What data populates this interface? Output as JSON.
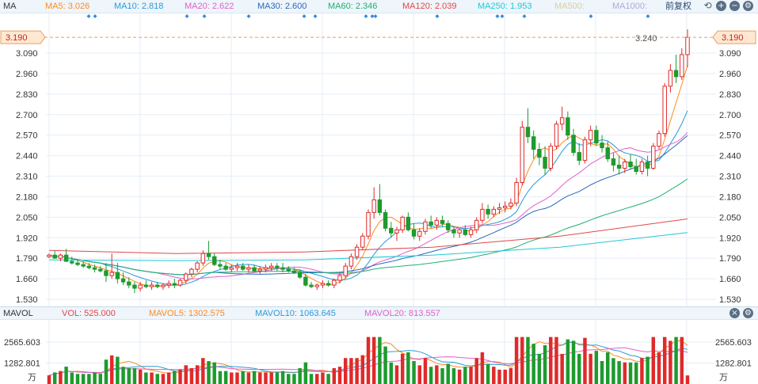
{
  "ma_bar": {
    "title": "MA",
    "items": [
      {
        "label": "MA5: 3.026",
        "color": "#ff8a1e"
      },
      {
        "label": "MA10: 2.818",
        "color": "#2a9bd8"
      },
      {
        "label": "MA20: 2.622",
        "color": "#e060c8"
      },
      {
        "label": "MA30: 2.600",
        "color": "#2b66c0"
      },
      {
        "label": "MA60: 2.346",
        "color": "#20b070"
      },
      {
        "label": "MA120: 2.039",
        "color": "#e04848"
      },
      {
        "label": "MA250: 1.953",
        "color": "#20c8d8"
      },
      {
        "label": "MA500:",
        "color": "#d8d0a0"
      },
      {
        "label": "MA1000:",
        "color": "#b0a8d8"
      }
    ],
    "adjust_label": "前复权"
  },
  "vol_bar": {
    "title": "MAVOL",
    "items": [
      {
        "label": "VOL: 525.000",
        "color": "#e04848"
      },
      {
        "label": "MAVOL5: 1302.575",
        "color": "#ff8a1e"
      },
      {
        "label": "MAVOL10: 1063.645",
        "color": "#2a9bd8"
      },
      {
        "label": "MAVOL20: 813.557",
        "color": "#e060c8"
      }
    ]
  },
  "price_axis": {
    "ticks": [
      "3.090",
      "2.960",
      "2.830",
      "2.700",
      "2.570",
      "2.440",
      "2.310",
      "2.180",
      "2.050",
      "1.920",
      "1.790",
      "1.660",
      "1.530"
    ],
    "current_price": "3.190",
    "high_marker": "3.240"
  },
  "volume_axis": {
    "ticks": [
      "2565.603",
      "1282.801"
    ],
    "unit": "万"
  },
  "colors": {
    "up": "#e02a2a",
    "down": "#1e9a2e",
    "grid": "#e6eef6",
    "price_line": "#e8a060",
    "label_box_bg": "#ffe8d2"
  },
  "icons": [
    "restore-icon",
    "zoom-in-icon",
    "zoom-out-icon",
    "settings-icon",
    "close-icon"
  ],
  "chart_data": {
    "type": "candlestick",
    "y_range": [
      1.53,
      3.24
    ],
    "ohlc": [
      [
        1.8,
        1.82,
        1.79,
        1.81
      ],
      [
        1.81,
        1.84,
        1.8,
        1.79
      ],
      [
        1.79,
        1.82,
        1.77,
        1.81
      ],
      [
        1.81,
        1.85,
        1.79,
        1.77
      ],
      [
        1.77,
        1.8,
        1.75,
        1.76
      ],
      [
        1.76,
        1.78,
        1.74,
        1.75
      ],
      [
        1.75,
        1.77,
        1.73,
        1.74
      ],
      [
        1.74,
        1.76,
        1.72,
        1.73
      ],
      [
        1.73,
        1.75,
        1.7,
        1.72
      ],
      [
        1.72,
        1.74,
        1.7,
        1.71
      ],
      [
        1.71,
        1.76,
        1.64,
        1.68
      ],
      [
        1.68,
        1.82,
        1.66,
        1.7
      ],
      [
        1.7,
        1.76,
        1.63,
        1.66
      ],
      [
        1.66,
        1.7,
        1.62,
        1.64
      ],
      [
        1.64,
        1.67,
        1.6,
        1.62
      ],
      [
        1.62,
        1.64,
        1.57,
        1.6
      ],
      [
        1.6,
        1.64,
        1.58,
        1.62
      ],
      [
        1.62,
        1.65,
        1.6,
        1.61
      ],
      [
        1.61,
        1.64,
        1.59,
        1.62
      ],
      [
        1.62,
        1.64,
        1.6,
        1.61
      ],
      [
        1.61,
        1.63,
        1.59,
        1.62
      ],
      [
        1.62,
        1.65,
        1.6,
        1.63
      ],
      [
        1.63,
        1.66,
        1.6,
        1.62
      ],
      [
        1.62,
        1.66,
        1.61,
        1.65
      ],
      [
        1.65,
        1.7,
        1.63,
        1.69
      ],
      [
        1.69,
        1.73,
        1.67,
        1.72
      ],
      [
        1.72,
        1.77,
        1.7,
        1.76
      ],
      [
        1.76,
        1.84,
        1.74,
        1.82
      ],
      [
        1.82,
        1.9,
        1.78,
        1.8
      ],
      [
        1.8,
        1.82,
        1.74,
        1.75
      ],
      [
        1.75,
        1.78,
        1.72,
        1.74
      ],
      [
        1.74,
        1.76,
        1.71,
        1.72
      ],
      [
        1.72,
        1.75,
        1.7,
        1.73
      ],
      [
        1.73,
        1.76,
        1.71,
        1.74
      ],
      [
        1.74,
        1.76,
        1.71,
        1.72
      ],
      [
        1.72,
        1.75,
        1.7,
        1.73
      ],
      [
        1.73,
        1.75,
        1.7,
        1.71
      ],
      [
        1.71,
        1.74,
        1.69,
        1.72
      ],
      [
        1.72,
        1.75,
        1.7,
        1.73
      ],
      [
        1.73,
        1.76,
        1.71,
        1.74
      ],
      [
        1.74,
        1.76,
        1.71,
        1.73
      ],
      [
        1.73,
        1.76,
        1.7,
        1.72
      ],
      [
        1.72,
        1.74,
        1.7,
        1.71
      ],
      [
        1.71,
        1.73,
        1.69,
        1.7
      ],
      [
        1.7,
        1.72,
        1.66,
        1.67
      ],
      [
        1.67,
        1.69,
        1.61,
        1.62
      ],
      [
        1.62,
        1.64,
        1.6,
        1.61
      ],
      [
        1.61,
        1.63,
        1.59,
        1.62
      ],
      [
        1.62,
        1.65,
        1.6,
        1.63
      ],
      [
        1.63,
        1.65,
        1.61,
        1.62
      ],
      [
        1.62,
        1.66,
        1.6,
        1.65
      ],
      [
        1.65,
        1.7,
        1.63,
        1.68
      ],
      [
        1.68,
        1.76,
        1.66,
        1.74
      ],
      [
        1.74,
        1.82,
        1.72,
        1.8
      ],
      [
        1.8,
        1.88,
        1.78,
        1.86
      ],
      [
        1.86,
        1.95,
        1.84,
        1.93
      ],
      [
        1.93,
        2.1,
        1.91,
        2.08
      ],
      [
        2.08,
        2.24,
        2.04,
        2.16
      ],
      [
        2.16,
        2.26,
        2.06,
        2.08
      ],
      [
        2.08,
        2.1,
        1.96,
        1.98
      ],
      [
        1.98,
        2.02,
        1.92,
        1.95
      ],
      [
        1.95,
        1.99,
        1.9,
        1.97
      ],
      [
        1.97,
        2.06,
        1.95,
        2.05
      ],
      [
        2.05,
        2.08,
        1.96,
        1.97
      ],
      [
        1.97,
        2.01,
        1.91,
        1.93
      ],
      [
        1.93,
        1.98,
        1.9,
        1.96
      ],
      [
        1.96,
        2.04,
        1.94,
        2.02
      ],
      [
        2.02,
        2.06,
        1.98,
        2.0
      ],
      [
        2.0,
        2.05,
        1.97,
        2.03
      ],
      [
        2.03,
        2.06,
        1.99,
        2.01
      ],
      [
        2.01,
        2.03,
        1.95,
        1.97
      ],
      [
        1.97,
        1.99,
        1.92,
        1.95
      ],
      [
        1.95,
        1.98,
        1.92,
        1.97
      ],
      [
        1.97,
        2.0,
        1.93,
        1.94
      ],
      [
        1.94,
        1.99,
        1.92,
        1.97
      ],
      [
        1.97,
        2.05,
        1.95,
        2.03
      ],
      [
        2.03,
        2.14,
        2.01,
        2.1
      ],
      [
        2.1,
        2.13,
        2.04,
        2.07
      ],
      [
        2.07,
        2.12,
        2.05,
        2.1
      ],
      [
        2.1,
        2.14,
        2.07,
        2.11
      ],
      [
        2.11,
        2.15,
        2.08,
        2.12
      ],
      [
        2.12,
        2.17,
        2.1,
        2.14
      ],
      [
        2.14,
        2.3,
        2.12,
        2.27
      ],
      [
        2.27,
        2.66,
        2.25,
        2.62
      ],
      [
        2.62,
        2.74,
        2.52,
        2.56
      ],
      [
        2.56,
        2.6,
        2.42,
        2.48
      ],
      [
        2.48,
        2.52,
        2.38,
        2.43
      ],
      [
        2.43,
        2.5,
        2.32,
        2.36
      ],
      [
        2.36,
        2.52,
        2.34,
        2.5
      ],
      [
        2.5,
        2.66,
        2.48,
        2.64
      ],
      [
        2.64,
        2.75,
        2.6,
        2.68
      ],
      [
        2.68,
        2.72,
        2.54,
        2.57
      ],
      [
        2.57,
        2.61,
        2.44,
        2.46
      ],
      [
        2.46,
        2.52,
        2.38,
        2.41
      ],
      [
        2.41,
        2.56,
        2.39,
        2.54
      ],
      [
        2.54,
        2.63,
        2.5,
        2.6
      ],
      [
        2.6,
        2.63,
        2.5,
        2.52
      ],
      [
        2.52,
        2.57,
        2.46,
        2.49
      ],
      [
        2.49,
        2.53,
        2.4,
        2.42
      ],
      [
        2.42,
        2.46,
        2.34,
        2.38
      ],
      [
        2.38,
        2.44,
        2.32,
        2.36
      ],
      [
        2.36,
        2.42,
        2.33,
        2.4
      ],
      [
        2.4,
        2.45,
        2.35,
        2.37
      ],
      [
        2.37,
        2.42,
        2.32,
        2.34
      ],
      [
        2.34,
        2.42,
        2.32,
        2.4
      ],
      [
        2.4,
        2.44,
        2.31,
        2.36
      ],
      [
        2.36,
        2.52,
        2.35,
        2.5
      ],
      [
        2.5,
        2.6,
        2.48,
        2.58
      ],
      [
        2.58,
        2.9,
        2.56,
        2.88
      ],
      [
        2.88,
        3.02,
        2.84,
        2.98
      ],
      [
        2.98,
        3.08,
        2.9,
        2.94
      ],
      [
        2.94,
        3.12,
        2.92,
        3.08
      ],
      [
        3.08,
        3.24,
        3.0,
        3.19
      ]
    ]
  }
}
